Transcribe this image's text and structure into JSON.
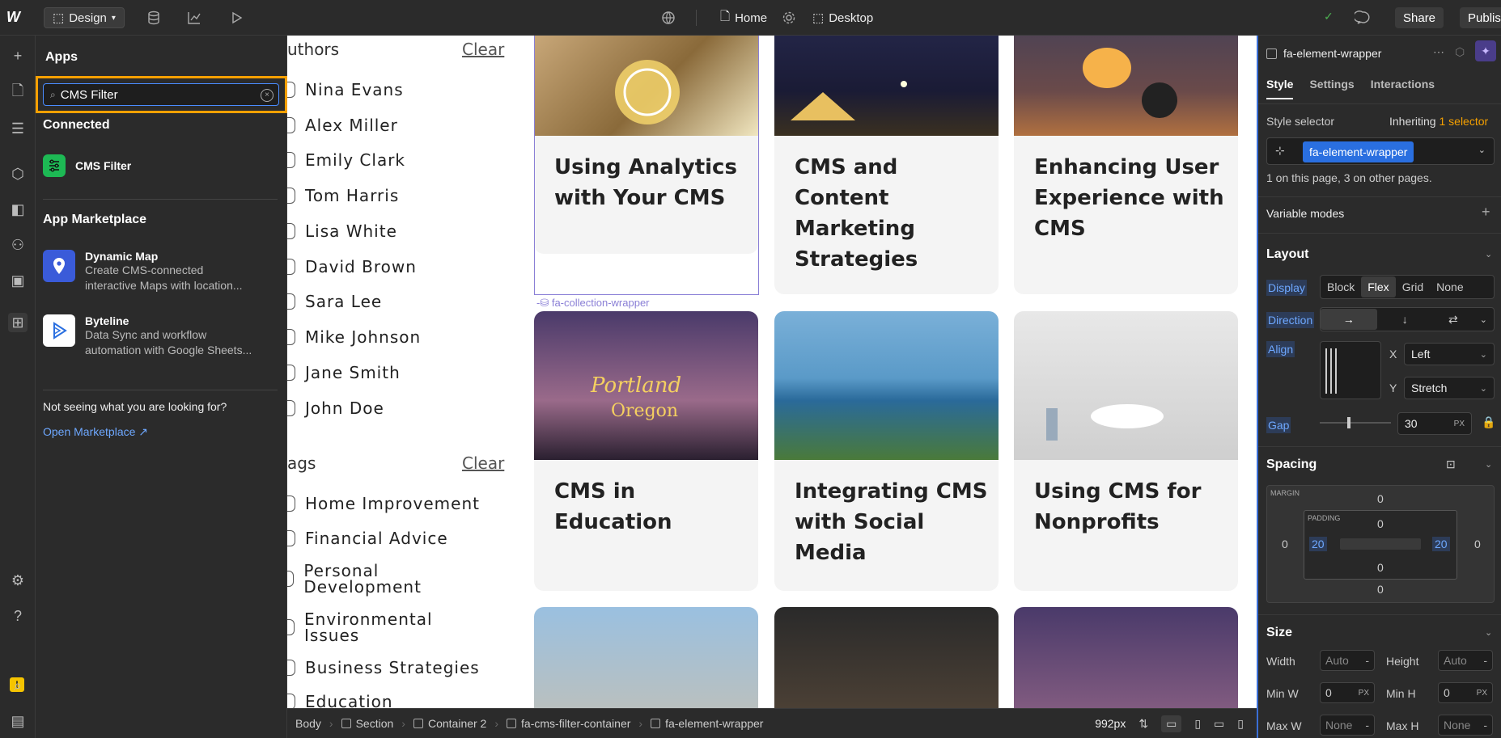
{
  "topbar": {
    "mode_label": "Design",
    "page_name": "Home",
    "breakpoint_name": "Desktop",
    "share_label": "Share",
    "publish_label": "Publish"
  },
  "apps_panel": {
    "title": "Apps",
    "search_value": "CMS Filter",
    "connected_heading": "Connected",
    "connected_apps": [
      {
        "name": "CMS Filter"
      }
    ],
    "marketplace_heading": "App Marketplace",
    "marketplace_apps": [
      {
        "name": "Dynamic Map",
        "desc_line1": "Create CMS-connected",
        "desc_line2": "interactive Maps with location..."
      },
      {
        "name": "Byteline",
        "desc_line1": "Data Sync and workflow",
        "desc_line2": "automation with Google Sheets..."
      }
    ],
    "not_seeing_text": "Not seeing what you are looking for?",
    "open_marketplace_label": "Open Marketplace ↗"
  },
  "canvas": {
    "authors_heading": "uthors",
    "authors_clear": "Clear",
    "authors": [
      "Nina Evans",
      "Alex Miller",
      "Emily Clark",
      "Tom Harris",
      "Lisa White",
      "David Brown",
      "Sara Lee",
      "Mike Johnson",
      "Jane Smith",
      "John Doe"
    ],
    "tags_heading": "ags",
    "tags_clear": "Clear",
    "tags": [
      "Home Improvement",
      "Financial Advice",
      "Personal Development",
      "Environmental Issues",
      "Business Strategies",
      "Education"
    ],
    "collection_label": "fa-collection-wrapper",
    "cards": [
      {
        "title": "Using Analytics with Your CMS"
      },
      {
        "title": "CMS and Content Marketing Strategies"
      },
      {
        "title": "Enhancing User Experience with CMS"
      },
      {
        "title": "CMS in Education"
      },
      {
        "title": "Integrating CMS with Social Media"
      },
      {
        "title": "Using CMS for Nonprofits"
      }
    ]
  },
  "breadcrumb": {
    "items": [
      "Body",
      "Section",
      "Container 2",
      "fa-cms-filter-container",
      "fa-element-wrapper"
    ],
    "width_readout": "992px"
  },
  "right_panel": {
    "element_name": "fa-element-wrapper",
    "tabs": [
      "Style",
      "Settings",
      "Interactions"
    ],
    "style_selector_label": "Style selector",
    "inheriting_label": "Inheriting",
    "inheriting_count": "1 selector",
    "selector_chip": "fa-element-wrapper",
    "usage_text": "1 on this page, 3 on other pages.",
    "variable_modes": "Variable modes",
    "layout_heading": "Layout",
    "display_label": "Display",
    "display_options": [
      "Block",
      "Flex",
      "Grid",
      "None"
    ],
    "direction_label": "Direction",
    "align_label": "Align",
    "align_x_label": "X",
    "align_x_value": "Left",
    "align_y_label": "Y",
    "align_y_value": "Stretch",
    "gap_label": "Gap",
    "gap_value": "30",
    "gap_unit": "PX",
    "spacing_heading": "Spacing",
    "margin_label": "MARGIN",
    "padding_label": "PADDING",
    "margin_top": "0",
    "margin_left": "0",
    "margin_right": "0",
    "margin_bottom": "0",
    "padding_top": "0",
    "padding_left": "20",
    "padding_right": "20",
    "padding_bottom": "0",
    "size_heading": "Size",
    "width_label": "Width",
    "width_value": "Auto",
    "height_label": "Height",
    "height_value": "Auto",
    "minw_label": "Min W",
    "minw_value": "0",
    "minh_label": "Min H",
    "minh_value": "0",
    "maxw_label": "Max W",
    "maxw_value": "None",
    "maxh_label": "Max H",
    "maxh_value": "None",
    "px_unit": "PX"
  }
}
